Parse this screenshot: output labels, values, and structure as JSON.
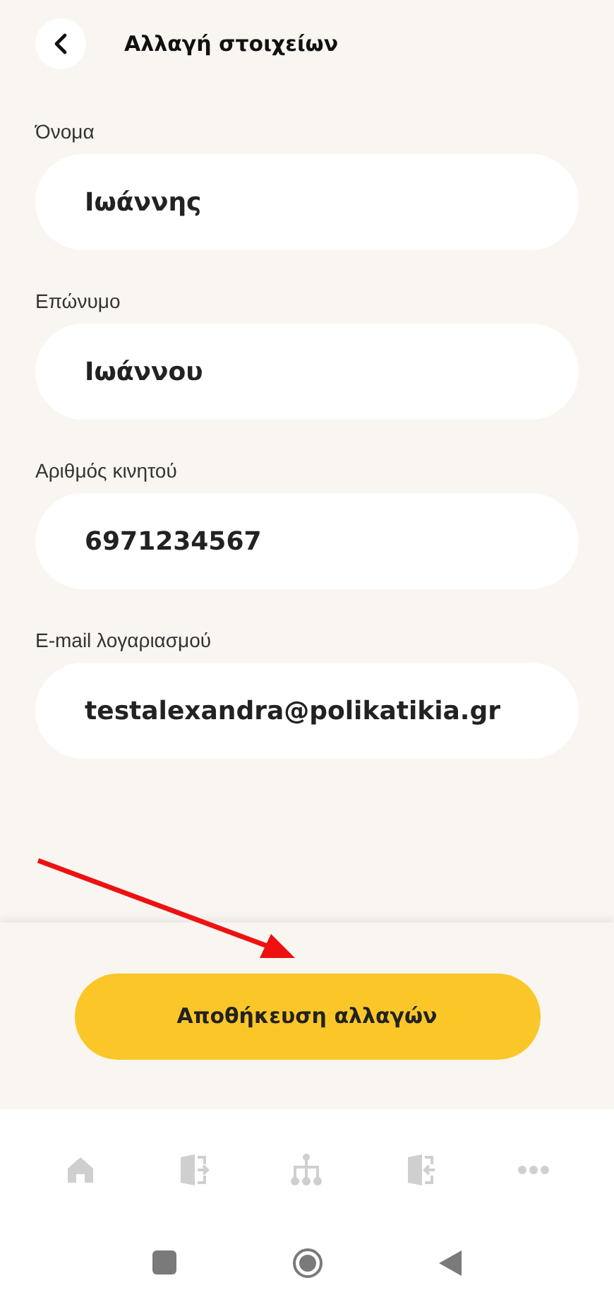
{
  "header": {
    "title": "Αλλαγή στοιχείων"
  },
  "fields": [
    {
      "label": "Όνομα",
      "value": "Ιωάννης"
    },
    {
      "label": "Επώνυμο",
      "value": "Ιωάννου"
    },
    {
      "label": "Αριθμός κινητού",
      "value": "6971234567"
    },
    {
      "label": "E-mail λογαριασμού",
      "value": "testalexandra@polikatikia.gr"
    }
  ],
  "save_button": {
    "label": "Αποθήκευση αλλαγών"
  },
  "bottom_nav": [
    {
      "kind": "home"
    },
    {
      "kind": "exit"
    },
    {
      "kind": "tree"
    },
    {
      "kind": "enter"
    },
    {
      "kind": "more"
    }
  ]
}
